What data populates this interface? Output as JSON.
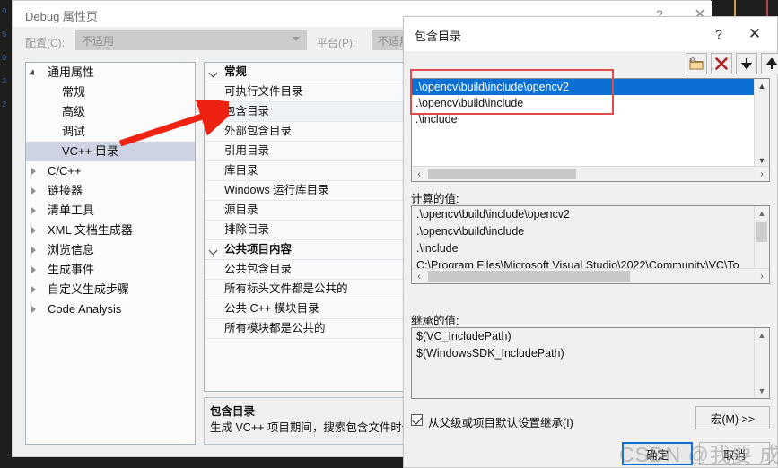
{
  "window": {
    "title": "Debug 属性页",
    "help_glyph": "?",
    "close_glyph": "✕"
  },
  "config_bar": {
    "configuration_label": "配置(C):",
    "configuration_value": "不适用",
    "platform_label": "平台(P):",
    "platform_value": "不适用"
  },
  "tree": {
    "nodes": [
      {
        "label": "通用属性",
        "level": 0,
        "state": "expanded",
        "selected": false
      },
      {
        "label": "常规",
        "level": 1,
        "state": "leaf",
        "selected": false
      },
      {
        "label": "高级",
        "level": 1,
        "state": "leaf",
        "selected": false
      },
      {
        "label": "调试",
        "level": 1,
        "state": "leaf",
        "selected": false
      },
      {
        "label": "VC++ 目录",
        "level": 1,
        "state": "leaf",
        "selected": true
      },
      {
        "label": "C/C++",
        "level": 0,
        "state": "collapsed",
        "selected": false
      },
      {
        "label": "链接器",
        "level": 0,
        "state": "collapsed",
        "selected": false
      },
      {
        "label": "清单工具",
        "level": 0,
        "state": "collapsed",
        "selected": false
      },
      {
        "label": "XML 文档生成器",
        "level": 0,
        "state": "collapsed",
        "selected": false
      },
      {
        "label": "浏览信息",
        "level": 0,
        "state": "collapsed",
        "selected": false
      },
      {
        "label": "生成事件",
        "level": 0,
        "state": "collapsed",
        "selected": false
      },
      {
        "label": "自定义生成步骤",
        "level": 0,
        "state": "collapsed",
        "selected": false
      },
      {
        "label": "Code Analysis",
        "level": 0,
        "state": "collapsed",
        "selected": false
      }
    ]
  },
  "property_list": {
    "rows": [
      {
        "label": "常规",
        "group": true,
        "highlight": false
      },
      {
        "label": "可执行文件目录",
        "group": false,
        "highlight": false
      },
      {
        "label": "包含目录",
        "group": false,
        "highlight": true
      },
      {
        "label": "外部包含目录",
        "group": false,
        "highlight": false
      },
      {
        "label": "引用目录",
        "group": false,
        "highlight": false
      },
      {
        "label": "库目录",
        "group": false,
        "highlight": false
      },
      {
        "label": "Windows 运行库目录",
        "group": false,
        "highlight": false
      },
      {
        "label": "源目录",
        "group": false,
        "highlight": false
      },
      {
        "label": "排除目录",
        "group": false,
        "highlight": false
      },
      {
        "label": "公共项目内容",
        "group": true,
        "highlight": false
      },
      {
        "label": "公共包含目录",
        "group": false,
        "highlight": false
      },
      {
        "label": "所有标头文件都是公共的",
        "group": false,
        "highlight": false
      },
      {
        "label": "公共 C++ 模块目录",
        "group": false,
        "highlight": false
      },
      {
        "label": "所有模块都是公共的",
        "group": false,
        "highlight": false
      }
    ]
  },
  "description": {
    "title": "包含目录",
    "text": "生成 VC++ 项目期间，搜索包含文件时使用"
  },
  "dialog": {
    "title": "包含目录",
    "help_glyph": "?",
    "close_glyph": "✕",
    "toolbar": [
      {
        "name": "new-folder",
        "tooltip": "新行"
      },
      {
        "name": "delete",
        "tooltip": "删除"
      },
      {
        "name": "move-down",
        "tooltip": "下移"
      },
      {
        "name": "move-up",
        "tooltip": "上移"
      }
    ],
    "entries": [
      {
        "value": ".\\opencv\\build\\include\\opencv2",
        "selected": true
      },
      {
        "value": ".\\opencv\\build\\include",
        "selected": false
      },
      {
        "value": ".\\include",
        "selected": false
      }
    ],
    "evaluated": {
      "label": "计算的值:",
      "lines": [
        ".\\opencv\\build\\include\\opencv2",
        ".\\opencv\\build\\include",
        ".\\include",
        "C:\\Program Files\\Microsoft Visual Studio\\2022\\Community\\VC\\To"
      ]
    },
    "inherited": {
      "label": "继承的值:",
      "lines": [
        "$(VC_IncludePath)",
        "$(WindowsSDK_IncludePath)"
      ]
    },
    "inherit_checkbox": {
      "label": "从父级或项目默认设置继承(I)",
      "checked": true
    },
    "buttons": {
      "macro": "宏(M)  >>",
      "ok": "确定",
      "cancel": "取消"
    }
  },
  "annotations": {
    "arrow_color": "#ee2211",
    "rect_color": "#e24b4b",
    "watermark": "CSDN @我要 成果"
  },
  "gutter_numbers": [
    "",
    "0",
    "",
    "",
    "",
    "5",
    "0",
    "2",
    "2"
  ]
}
